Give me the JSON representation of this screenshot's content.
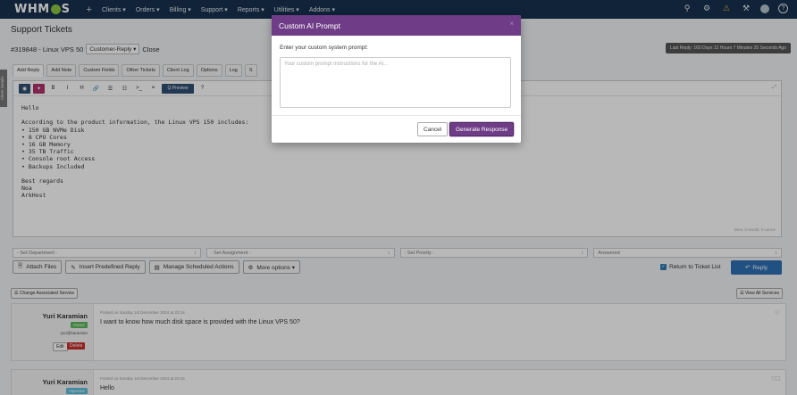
{
  "nav": {
    "logo_left": "WHM",
    "logo_right": "S",
    "plus": "+",
    "items": [
      "Clients ▾",
      "Orders ▾",
      "Billing ▾",
      "Support ▾",
      "Reports ▾",
      "Utilities ▾",
      "Addons ▾"
    ]
  },
  "page": {
    "title": "Support Tickets"
  },
  "ticket": {
    "id_title": "#319848 - Linux VPS 50",
    "status": "Customer-Reply",
    "close_label": "Close",
    "last_reply": "Last Reply: 160 Days 12 Hours 7 Minutes 25 Seconds Ago",
    "side_tab": "Client Details"
  },
  "tabs": [
    "Add Reply",
    "Add Note",
    "Custom Fields",
    "Other Tickets",
    "Client Log",
    "Options",
    "Log",
    "S"
  ],
  "toolbar": {
    "bold": "B",
    "italic": "I",
    "heading": "H",
    "link": "🔗",
    "list_ul": "☰",
    "list_ol": "☷",
    "code": ">_",
    "quote": "❝",
    "preview": "Q Preview",
    "help": "?"
  },
  "editor": {
    "body": "Hello\n\nAccording to the product information, the Linux VPS 150 includes:\n• 150 GB NVMe Disk\n• 8 CPU Cores\n• 16 GB Memory\n• 35 TB Traffic\n• Console root Access\n• Backups Included\n\nBest regards\nNoa\nArkHost",
    "stats": "lines: 0  words: 0  cursor"
  },
  "selects": [
    "- Set Department -",
    "- Set Assignment -",
    "- Set Priority -",
    "Answered"
  ],
  "actions": {
    "attach": "Attach Files",
    "predefined": "Insert Predefined Reply",
    "scheduled": "Manage Scheduled Actions",
    "more": "More options ▾",
    "return_label": "Return to Ticket List",
    "reply": "Reply"
  },
  "assoc": {
    "change": "Change Associated Service",
    "view_all": "View All Services"
  },
  "messages": [
    {
      "author": "Yuri Karamian",
      "badge": "Owner",
      "badge_color": "#5cb85c",
      "username": "yuri@karamian",
      "posted": "Posted on Sunday 1st December 2024 at 23:14",
      "text": "I want to know how much disk space is provided with the Linux VPS 50?",
      "edit": "Edit",
      "delete": "Delete"
    },
    {
      "author": "Yuri Karamian",
      "badge": "Operator",
      "badge_color": "#5bc0de",
      "posted": "Posted on Sunday 1st December 2024 at 23:15",
      "text": "Hello"
    }
  ],
  "modal": {
    "title": "Custom AI Prompt",
    "close": "×",
    "label": "Enter your custom system prompt:",
    "placeholder": "Your custom prompt instructions for the AI...",
    "cancel": "Cancel",
    "generate": "Generate Response"
  },
  "colors": {
    "nav_bg": "#17314f",
    "modal_header": "#6f3d87",
    "reply_button": "#2f6fb4"
  }
}
